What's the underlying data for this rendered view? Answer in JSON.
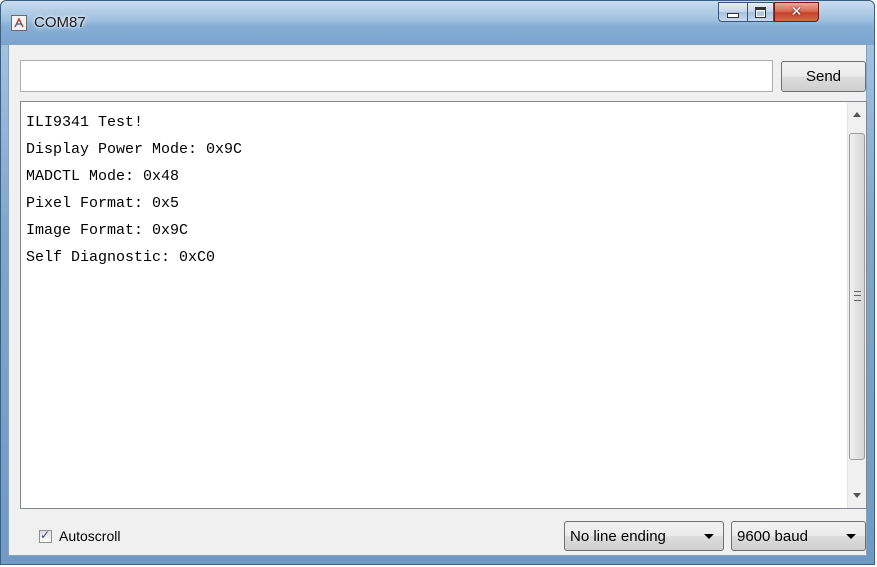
{
  "window": {
    "title": "COM87",
    "min_icon": "minimize-icon",
    "max_icon": "maximize-icon",
    "close_icon": "close-icon",
    "accent": "#6f9ac4"
  },
  "input": {
    "value": "",
    "placeholder": ""
  },
  "toolbar": {
    "send_label": "Send"
  },
  "output": {
    "lines": [
      "ILI9341 Test!",
      "Display Power Mode: 0x9C",
      "MADCTL Mode: 0x48",
      "Pixel Format: 0x5",
      "Image Format: 0x9C",
      "Self Diagnostic: 0xC0"
    ]
  },
  "footer": {
    "autoscroll_label": "Autoscroll",
    "autoscroll_checked": true,
    "line_ending": "No line ending",
    "baud": "9600 baud"
  }
}
